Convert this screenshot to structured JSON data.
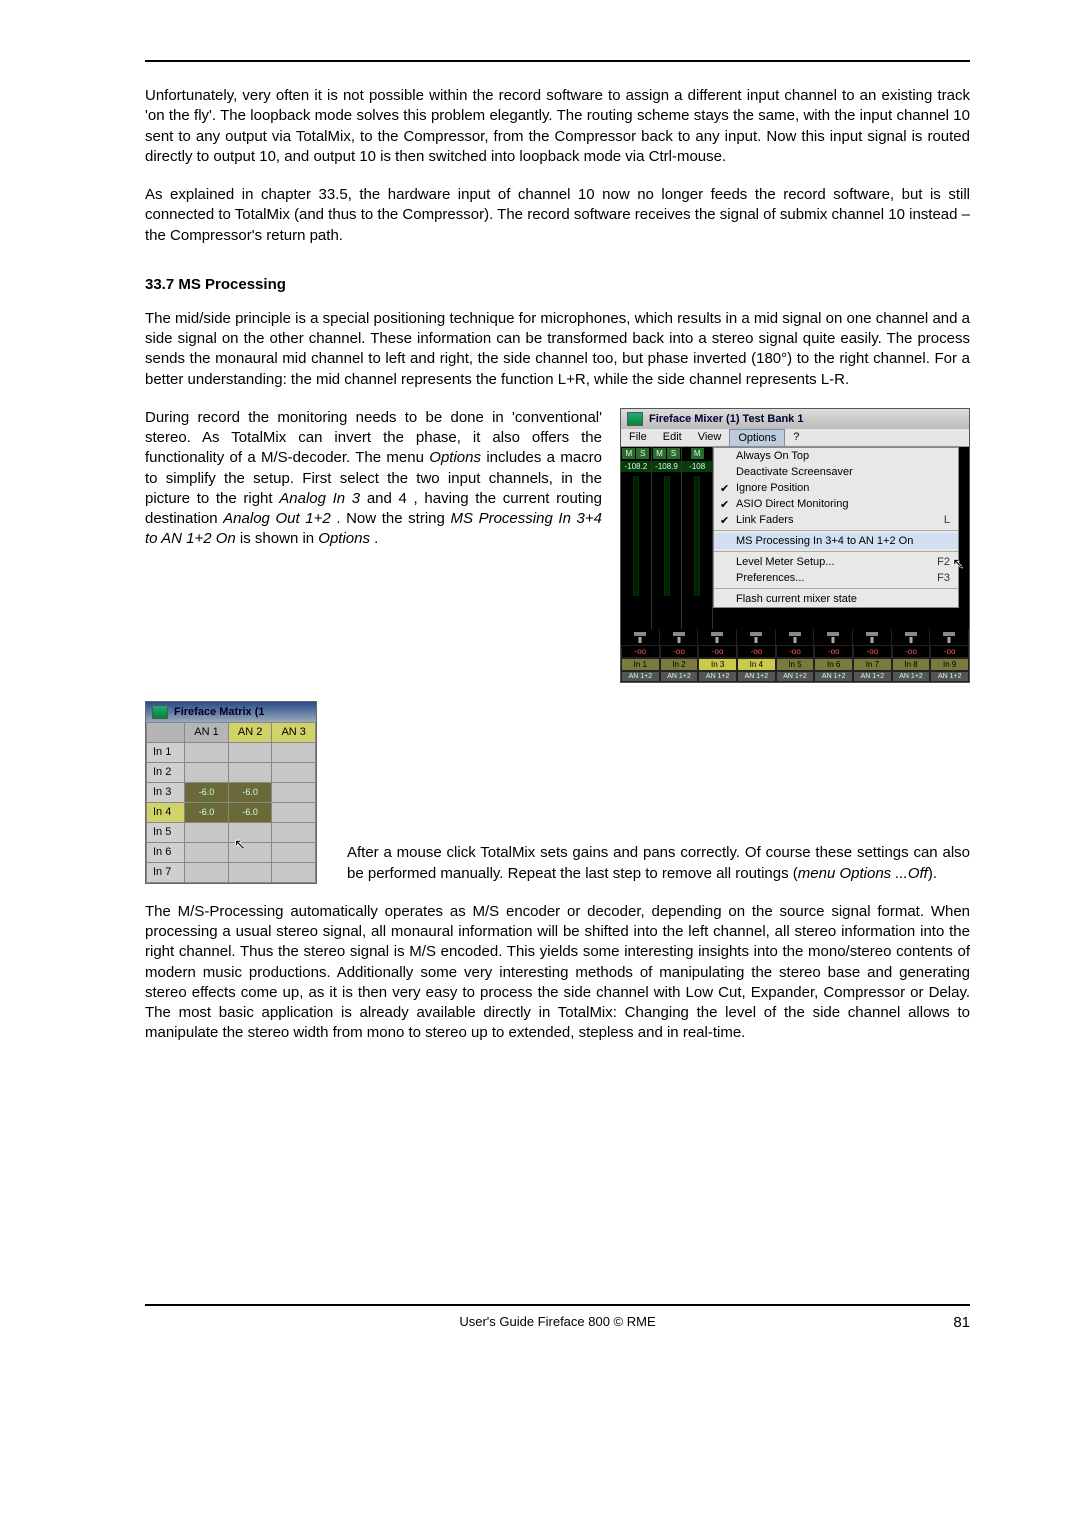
{
  "paragraphs": {
    "p1": "Unfortunately, very often it is not possible within the record software to assign a different input channel to an existing track 'on the fly'. The loopback mode solves this problem elegantly. The routing scheme stays the same, with the input channel 10 sent to any output via TotalMix, to the Compressor, from the Compressor back to any input. Now this input signal is routed directly to output 10, and output 10 is then switched into loopback mode via Ctrl-mouse.",
    "p2": "As explained in chapter 33.5, the hardware input of channel 10 now no longer feeds the record software, but is still connected to TotalMix (and thus to the Compressor). The record software receives the signal of submix channel 10 instead – the Compressor's return path.",
    "section": "33.7 MS Processing",
    "p3": "The mid/side principle is a special positioning technique for microphones, which results in a mid signal on one channel and a side signal on the other channel. These information can be transformed back into a stereo signal quite easily. The process sends the monaural mid channel to left and right, the side channel too, but phase inverted (180°) to the right channel. For a better understanding: the mid channel represents the function L+R, while the side channel represents L-R.",
    "p4a": "During record the monitoring needs to be done in 'conventional' stereo. As TotalMix can invert the phase, it also offers the functionality of a M/S-decoder. The menu ",
    "p4b": " includes a macro to simplify the setup. First select the two input channels, in the picture to the right ",
    "p4c": ", having the current routing destination ",
    "p4d": ". Now the string ",
    "p4e": " is shown in ",
    "p4f": ".",
    "p4_italics": {
      "options": "Options",
      "analog_in": "Analog In 3",
      "and4": " and 4",
      "analog_out": "Analog Out 1+2",
      "ms_string": "MS Processing In 3+4 to AN 1+2 On",
      "options2": "Options"
    },
    "p5": "After a mouse click TotalMix sets gains and pans correctly. Of course these settings can also be performed manually. Repeat the last step to remove all routings (",
    "p5_it": "menu Options ...Off",
    "p5_end": ").",
    "p6": "The M/S-Processing automatically operates as M/S encoder or decoder, depending on the source signal format. When processing a usual stereo signal, all monaural information will be shifted into the left channel, all stereo information into the right channel. Thus the stereo signal is M/S encoded. This yields some interesting insights into the mono/stereo contents of modern music productions. Additionally some very interesting methods of manipulating the stereo base and generating stereo effects come up, as it is then very easy to process the side channel with Low Cut, Expander, Compressor or Delay. The most basic application is already available directly in TotalMix: Changing the level of the side channel allows to manipulate the stereo width from mono to stereo up to extended, stepless and in real-time."
  },
  "mixer": {
    "title": "Fireface Mixer (1) Test Bank 1",
    "menus": [
      "File",
      "Edit",
      "View",
      "Options",
      "?"
    ],
    "open_menu": "Options",
    "levels": [
      "-108.2",
      "-108.9",
      "-108"
    ],
    "options_items": [
      {
        "label": "Always On Top",
        "chk": false
      },
      {
        "label": "Deactivate Screensaver",
        "chk": false
      },
      {
        "label": "Ignore Position",
        "chk": true
      },
      {
        "label": "ASIO Direct Monitoring",
        "chk": true
      },
      {
        "label": "Link Faders",
        "chk": true,
        "shortcut": "L"
      }
    ],
    "ms_item": "MS Processing In 3+4 to AN 1+2 On",
    "options_items2": [
      {
        "label": "Level Meter Setup...",
        "shortcut": "F2"
      },
      {
        "label": "Preferences...",
        "shortcut": "F3"
      }
    ],
    "options_item3": "Flash current mixer state",
    "bottom": {
      "vals": [
        "-oo",
        "-oo",
        "-oo",
        "-oo",
        "-oo",
        "-oo",
        "-oo",
        "-oo",
        "-oo"
      ],
      "ins": [
        "In 1",
        "In 2",
        "In 3",
        "In 4",
        "In 5",
        "In 6",
        "In 7",
        "In 8",
        "In 9"
      ],
      "selected": [
        2,
        3
      ],
      "ans": [
        "AN 1+2",
        "AN 1+2",
        "AN 1+2",
        "AN 1+2",
        "AN 1+2",
        "AN 1+2",
        "AN 1+2",
        "AN 1+2",
        "AN 1+2"
      ]
    }
  },
  "matrix": {
    "title": "Fireface Matrix (1",
    "cols": [
      "AN 1",
      "AN 2",
      "AN 3"
    ],
    "col_selected": [
      1,
      2
    ],
    "rows": [
      "In 1",
      "In 2",
      "In 3",
      "In 4",
      "In 5",
      "In 6",
      "In 7"
    ],
    "row_selected": [
      3
    ],
    "cells": {
      "2": {
        "0": "-6.0",
        "1": "-6.0"
      },
      "3": {
        "0": "-6.0",
        "1": "-6.0"
      }
    }
  },
  "footer": {
    "text": "User's Guide Fireface 800  ©  RME",
    "page": "81"
  }
}
